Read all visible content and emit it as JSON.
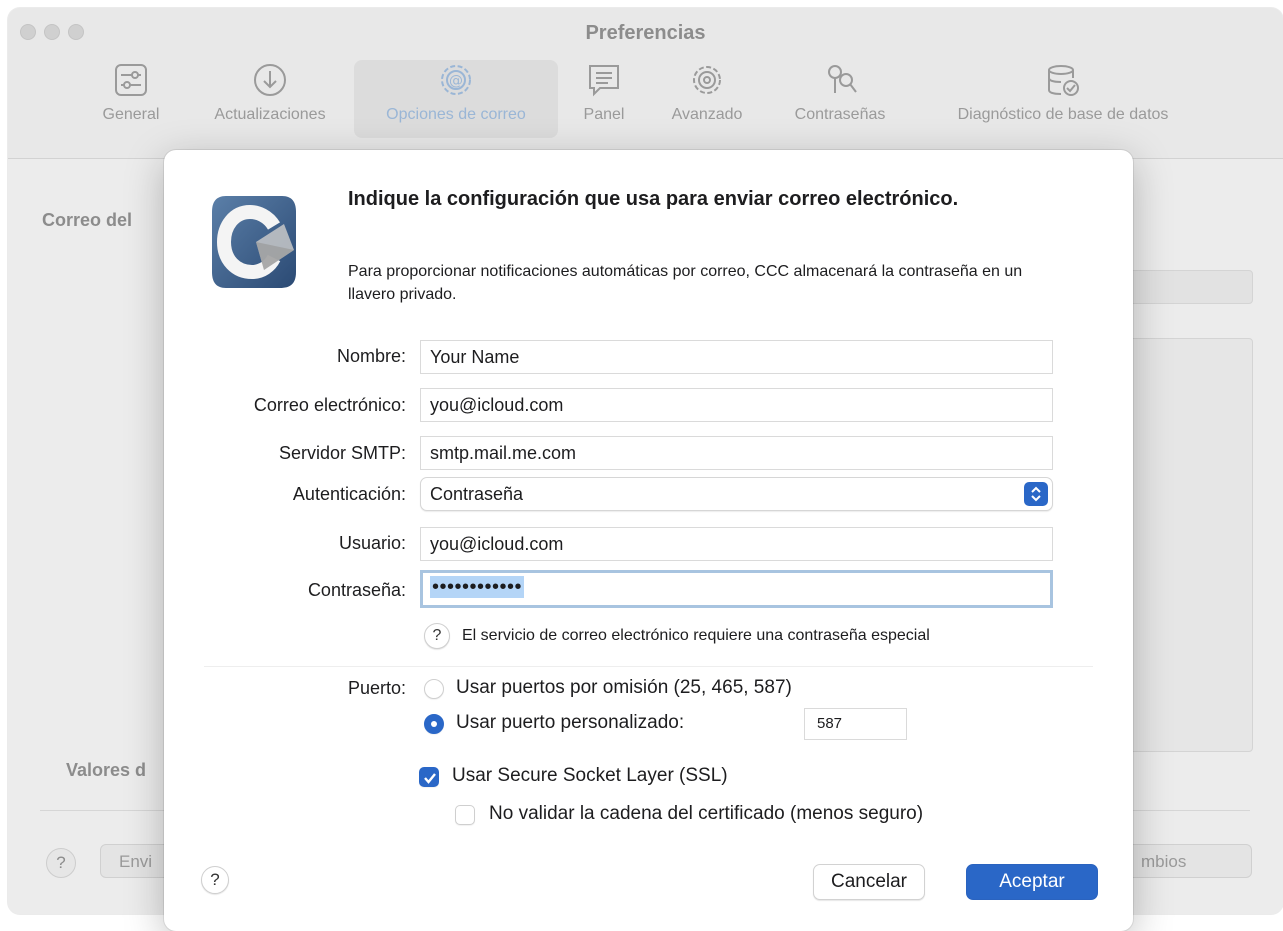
{
  "window": {
    "title": "Preferencias"
  },
  "toolbar": {
    "items": [
      {
        "label": "General",
        "icon": "sliders-icon"
      },
      {
        "label": "Actualizaciones",
        "icon": "download-icon"
      },
      {
        "label": "Opciones de correo",
        "icon": "at-gear-icon",
        "selected": true
      },
      {
        "label": "Panel",
        "icon": "panel-icon"
      },
      {
        "label": "Avanzado",
        "icon": "gear-icon"
      },
      {
        "label": "Contraseñas",
        "icon": "keys-icon"
      },
      {
        "label": "Diagnóstico de base de datos",
        "icon": "database-check-icon"
      }
    ]
  },
  "background": {
    "section1": "Correo del",
    "section2": "Valores d",
    "button_left": "Envi",
    "button_right": "mbios",
    "help": "?"
  },
  "dialog": {
    "heading": "Indique la configuración que usa para enviar correo electrónico.",
    "subtitle": "Para proporcionar notificaciones automáticas por correo, CCC almacenará la contraseña en un llavero privado.",
    "fields": {
      "name": {
        "label": "Nombre:",
        "value": "Your Name"
      },
      "email": {
        "label": "Correo electrónico:",
        "value": "you@icloud.com"
      },
      "smtp": {
        "label": "Servidor SMTP:",
        "value": "smtp.mail.me.com"
      },
      "auth": {
        "label": "Autenticación:",
        "value": "Contraseña"
      },
      "user": {
        "label": "Usuario:",
        "value": "you@icloud.com"
      },
      "password": {
        "label": "Contraseña:",
        "value": "••••••••••••"
      }
    },
    "password_help": "El servicio de correo electrónico requiere una contraseña especial",
    "port": {
      "label": "Puerto:",
      "default_option": "Usar puertos por omisión (25, 465, 587)",
      "custom_option": "Usar puerto personalizado:",
      "custom_value": "587",
      "selected": "custom"
    },
    "ssl": {
      "label": "Usar Secure Socket Layer (SSL)",
      "checked": true
    },
    "no_validate": {
      "label": "No validar la cadena del certificado (menos seguro)",
      "checked": false
    },
    "help": "?",
    "cancel": "Cancelar",
    "accept": "Aceptar"
  },
  "colors": {
    "accent": "#2a67c7",
    "selection": "#b4d5f7",
    "window_bg": "#ececec"
  }
}
